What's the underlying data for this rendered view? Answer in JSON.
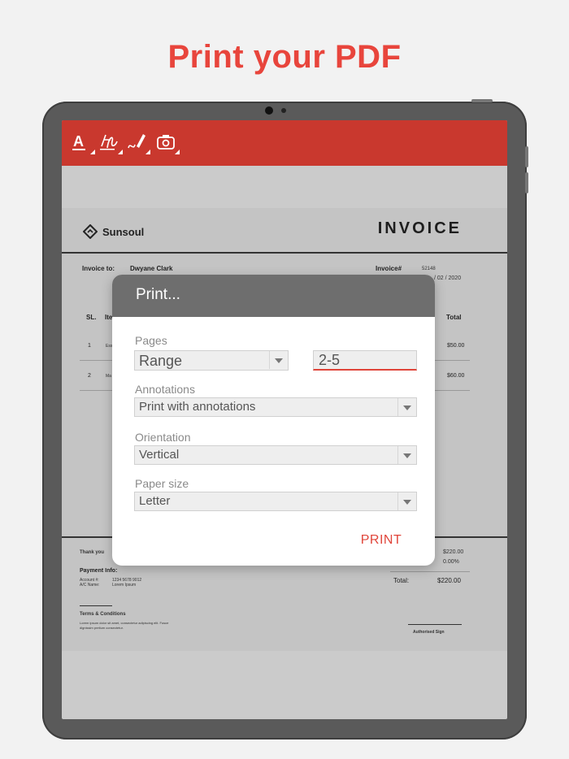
{
  "headline": "Print your PDF",
  "colors": {
    "accent": "#e8453c",
    "toolbar": "#c9382e",
    "dialog_header": "#6e6e6e"
  },
  "toolbar": {
    "tools": [
      {
        "icon": "text-annotation-icon"
      },
      {
        "icon": "signature-icon"
      },
      {
        "icon": "pen-draw-icon"
      },
      {
        "icon": "camera-icon"
      }
    ]
  },
  "invoice": {
    "brand": "Sunsoul",
    "title": "INVOICE",
    "invoice_to_label": "Invoice to:",
    "invoice_to_name": "Dwyane Clark",
    "invoice_no_label": "Invoice#",
    "invoice_no": "52148",
    "date_fragment": "/ 02 / 2020",
    "col_sl": "SL.",
    "col_item_fragment": "Ite",
    "col_total": "Total",
    "rows": [
      {
        "sl": "1",
        "item_fragment": "Ess",
        "total": "$50.00"
      },
      {
        "sl": "2",
        "item_fragment": "Ma",
        "total": "$60.00"
      }
    ],
    "thank_you_fragment": "Thank you",
    "subtotal": "$220.00",
    "tax": "0.00%",
    "total_label": "Total:",
    "total_value": "$220.00",
    "payment_info_label": "Payment Info:",
    "account_label": "Account #:",
    "account_value": "1234 5678 9012",
    "ac_name_label": "A/C Name:",
    "ac_name_value": "Lorem Ipsum",
    "terms_label": "Terms & Conditions",
    "terms_text_1": "Lorem ipsum dolor sit amet, consectetur adipiscing elit. Fusce",
    "terms_text_2": "dignissim pretium consectetur.",
    "authorised_sign": "Authorised Sign"
  },
  "dialog": {
    "title": "Print...",
    "pages_label": "Pages",
    "pages_value": "Range",
    "range_value": "2-5",
    "annotations_label": "Annotations",
    "annotations_value": "Print with annotations",
    "orientation_label": "Orientation",
    "orientation_value": "Vertical",
    "paper_label": "Paper size",
    "paper_value": "Letter",
    "print_label": "PRINT"
  }
}
